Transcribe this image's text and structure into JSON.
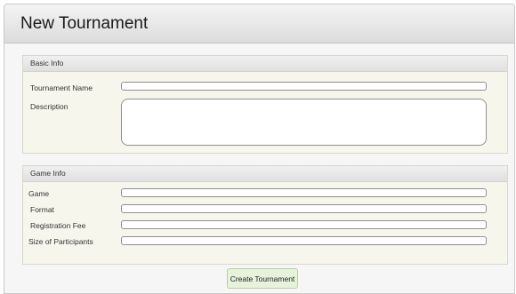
{
  "page": {
    "title": "New Tournament"
  },
  "basic_info": {
    "title": "Basic Info",
    "tournament_name_label": "Tournament Name",
    "tournament_name_value": "",
    "description_label": "Description",
    "description_value": ""
  },
  "game_info": {
    "title": "Game Info",
    "game_label": "Game",
    "game_value": "",
    "format_label": "Format",
    "format_value": "",
    "registration_fee_label": "Registration Fee",
    "registration_fee_value": "",
    "size_label": "Size of Participants",
    "size_value": ""
  },
  "actions": {
    "create_label": "Create Tournament"
  }
}
